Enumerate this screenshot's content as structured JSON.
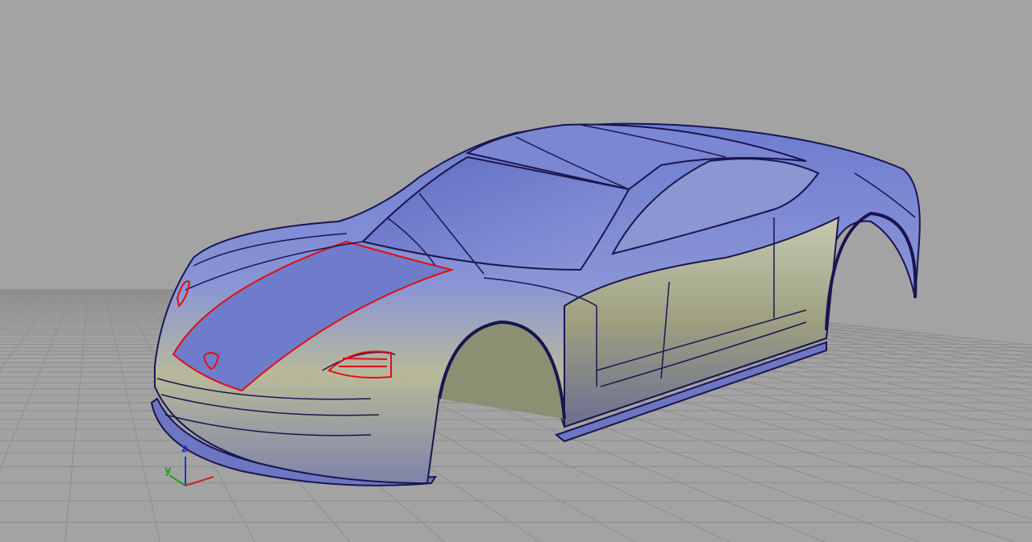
{
  "viewport": {
    "background_color": "#a3a3a3",
    "grid_color": "#8e8e8e",
    "model": {
      "body_color_top": "#7a86d8",
      "body_color_bottom": "#a9aa8a",
      "edge_color": "#1a1450",
      "selected_edge_color": "#e01010"
    },
    "axis_triad": {
      "x_color": "#d02020",
      "y_color": "#20a020",
      "z_color": "#2030d0",
      "y_label": "y",
      "z_label": "z"
    }
  }
}
